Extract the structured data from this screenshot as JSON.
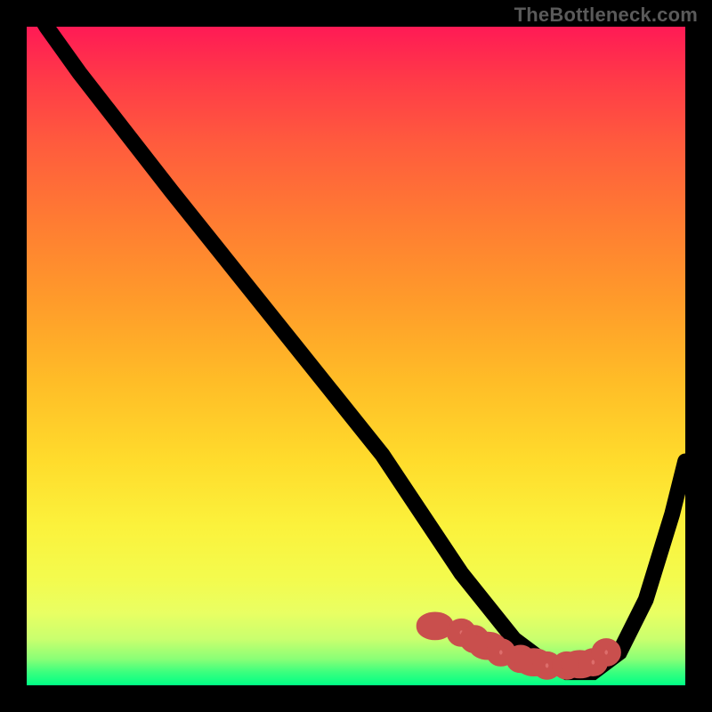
{
  "watermark": "TheBottleneck.com",
  "colors": {
    "background": "#000000",
    "marker_fill": "#dd6d6b",
    "marker_stroke": "#c94f4d",
    "curve_stroke": "#000000",
    "gradient_top": "#ff1a55",
    "gradient_bottom": "#00ff85"
  },
  "chart_data": {
    "type": "line",
    "title": "",
    "xlabel": "",
    "ylabel": "",
    "xlim": [
      0,
      100
    ],
    "ylim": [
      0,
      100
    ],
    "grid": false,
    "legend": false,
    "annotations": [
      "TheBottleneck.com"
    ],
    "series": [
      {
        "name": "curve",
        "x": [
          0,
          3,
          8,
          15,
          22,
          30,
          38,
          46,
          54,
          58,
          62,
          66,
          70,
          74,
          78,
          82,
          86,
          90,
          94,
          98,
          100
        ],
        "values": [
          105,
          100,
          93,
          84,
          75,
          65,
          55,
          45,
          35,
          29,
          23,
          17,
          12,
          7,
          4,
          2,
          2,
          5,
          13,
          26,
          34
        ]
      }
    ],
    "markers": {
      "name": "highlight-points",
      "x": [
        62,
        66,
        68,
        70,
        72,
        75,
        77,
        79,
        82,
        84,
        86,
        88
      ],
      "values": [
        9,
        8,
        7,
        6,
        5,
        4,
        3.5,
        3,
        3,
        3.2,
        3.5,
        5
      ]
    }
  }
}
